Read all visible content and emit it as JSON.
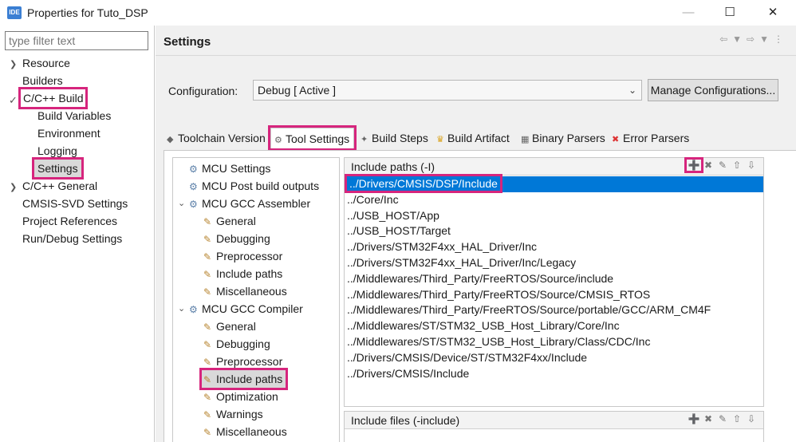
{
  "window": {
    "app_icon": "IDE",
    "title": "Properties for Tuto_DSP"
  },
  "filter": {
    "placeholder": "type filter text"
  },
  "sidebar": {
    "items": [
      {
        "label": "Resource"
      },
      {
        "label": "Builders"
      },
      {
        "label": "C/C++ Build"
      },
      {
        "label": "Build Variables"
      },
      {
        "label": "Environment"
      },
      {
        "label": "Logging"
      },
      {
        "label": "Settings"
      },
      {
        "label": "C/C++ General"
      },
      {
        "label": "CMSIS-SVD Settings"
      },
      {
        "label": "Project References"
      },
      {
        "label": "Run/Debug Settings"
      }
    ]
  },
  "settings": {
    "title": "Settings",
    "config_label": "Configuration:",
    "config_value": "Debug  [ Active ]",
    "manage_label": "Manage Configurations..."
  },
  "tabs": [
    {
      "label": "Toolchain Version"
    },
    {
      "label": "Tool Settings"
    },
    {
      "label": "Build Steps"
    },
    {
      "label": "Build Artifact"
    },
    {
      "label": "Binary Parsers"
    },
    {
      "label": "Error Parsers"
    }
  ],
  "tool_tree": [
    {
      "label": "MCU Settings"
    },
    {
      "label": "MCU Post build outputs"
    },
    {
      "label": "MCU GCC Assembler"
    },
    {
      "label": "General"
    },
    {
      "label": "Debugging"
    },
    {
      "label": "Preprocessor"
    },
    {
      "label": "Include paths"
    },
    {
      "label": "Miscellaneous"
    },
    {
      "label": "MCU GCC Compiler"
    },
    {
      "label": "General"
    },
    {
      "label": "Debugging"
    },
    {
      "label": "Preprocessor"
    },
    {
      "label": "Include paths"
    },
    {
      "label": "Optimization"
    },
    {
      "label": "Warnings"
    },
    {
      "label": "Miscellaneous"
    }
  ],
  "include_paths": {
    "title": "Include paths (-I)",
    "paths": [
      "../Drivers/CMSIS/DSP/Include",
      "../Core/Inc",
      "../USB_HOST/App",
      "../USB_HOST/Target",
      "../Drivers/STM32F4xx_HAL_Driver/Inc",
      "../Drivers/STM32F4xx_HAL_Driver/Inc/Legacy",
      "../Middlewares/Third_Party/FreeRTOS/Source/include",
      "../Middlewares/Third_Party/FreeRTOS/Source/CMSIS_RTOS",
      "../Middlewares/Third_Party/FreeRTOS/Source/portable/GCC/ARM_CM4F",
      "../Middlewares/ST/STM32_USB_Host_Library/Core/Inc",
      "../Middlewares/ST/STM32_USB_Host_Library/Class/CDC/Inc",
      "../Drivers/CMSIS/Device/ST/STM32F4xx/Include",
      "../Drivers/CMSIS/Include"
    ]
  },
  "include_files": {
    "title": "Include files (-include)"
  },
  "colors": {
    "highlight": "#d6257d",
    "selection": "#0078d7"
  }
}
